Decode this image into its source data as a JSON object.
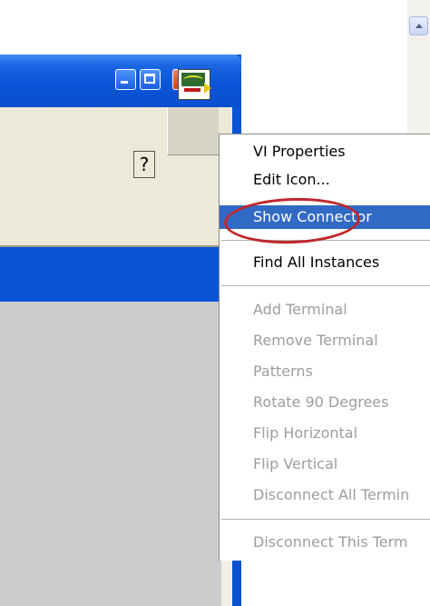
{
  "window": {
    "title_buttons": {
      "minimize": "minimize-icon",
      "maximize": "maximize-icon",
      "close": "close-icon"
    },
    "help_icon": "?",
    "vi_icon": "vi-connector-icon"
  },
  "context_menu": {
    "items": [
      {
        "label": "VI Properties",
        "enabled": true
      },
      {
        "label": "Edit Icon...",
        "enabled": true
      },
      {
        "label": "Show Connector",
        "enabled": true,
        "highlighted": true
      },
      {
        "label": "Find All Instances",
        "enabled": true
      },
      {
        "label": "Add Terminal",
        "enabled": false
      },
      {
        "label": "Remove Terminal",
        "enabled": false
      },
      {
        "label": "Patterns",
        "enabled": false
      },
      {
        "label": "Rotate 90 Degrees",
        "enabled": false
      },
      {
        "label": "Flip Horizontal",
        "enabled": false
      },
      {
        "label": "Flip Vertical",
        "enabled": false
      },
      {
        "label": "Disconnect All Termin",
        "enabled": false
      },
      {
        "label": "Disconnect This Term",
        "enabled": false
      }
    ]
  },
  "colors": {
    "title_bar": "#0a55d8",
    "menu_highlight": "#316ac5",
    "annotation_ring": "#c0262b",
    "disabled_text": "#9d9d9d"
  }
}
